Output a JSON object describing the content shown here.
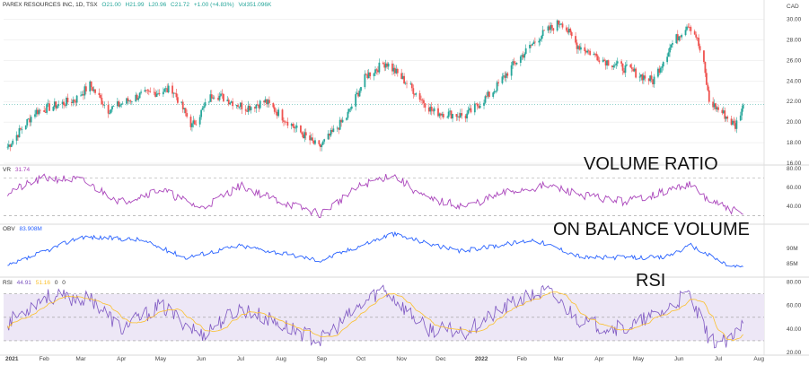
{
  "header": {
    "symbol_line": "PAREX RESOURCES INC, 1D, TSX",
    "open": "O21.00",
    "high": "H21.99",
    "low": "L20.96",
    "close": "C21.72",
    "change": "+1.00 (+4.83%)",
    "volume": "Vol351.096K"
  },
  "currency": "CAD",
  "colors": {
    "up": "#26a69a",
    "down": "#ef5350",
    "vr": "#ab47bc",
    "obv": "#2962ff",
    "rsi": "#7e57c2",
    "rsi_ma": "#fbc02d",
    "rsi_band": "#ede7f6",
    "grid": "#e6e6e6",
    "axis_text": "#444444"
  },
  "annotations": {
    "volume_ratio": "VOLUME RATIO",
    "obv": "ON BALANCE VOLUME",
    "rsi": "RSI"
  },
  "panes": {
    "vr": {
      "name": "VR",
      "value": "31.74"
    },
    "obv": {
      "name": "OBV",
      "value": "83.908M"
    },
    "rsi": {
      "name": "RSI",
      "value": "44.91",
      "ma_value": "51.16",
      "extra1": "0",
      "extra2": "0"
    }
  },
  "chart_data": {
    "type": "candlestick",
    "x_axis_labels": [
      "2021",
      "Feb",
      "Mar",
      "Apr",
      "May",
      "Jun",
      "Jul",
      "Aug",
      "Sep",
      "Oct",
      "Nov",
      "Dec",
      "2022",
      "Feb",
      "Mar",
      "Apr",
      "May",
      "Jun",
      "Jul",
      "Aug"
    ],
    "price_axis": {
      "ticks": [
        "30.00",
        "28.00",
        "26.00",
        "24.00",
        "22.00",
        "20.00",
        "18.00",
        "16.00"
      ],
      "ylim": [
        16,
        31
      ]
    },
    "price_key_points": [
      {
        "date": "2021-01-04",
        "close": 17.6
      },
      {
        "date": "2021-01-25",
        "close": 21.0
      },
      {
        "date": "2021-02-25",
        "close": 22.2
      },
      {
        "date": "2021-03-08",
        "close": 23.6
      },
      {
        "date": "2021-03-22",
        "close": 21.2
      },
      {
        "date": "2021-04-15",
        "close": 22.6
      },
      {
        "date": "2021-05-10",
        "close": 23.2
      },
      {
        "date": "2021-05-25",
        "close": 19.6
      },
      {
        "date": "2021-06-10",
        "close": 22.8
      },
      {
        "date": "2021-07-05",
        "close": 21.4
      },
      {
        "date": "2021-07-20",
        "close": 22.0
      },
      {
        "date": "2021-08-12",
        "close": 19.4
      },
      {
        "date": "2021-08-30",
        "close": 17.5
      },
      {
        "date": "2021-09-20",
        "close": 20.5
      },
      {
        "date": "2021-10-05",
        "close": 24.5
      },
      {
        "date": "2021-10-20",
        "close": 25.8
      },
      {
        "date": "2021-11-05",
        "close": 23.8
      },
      {
        "date": "2021-11-25",
        "close": 21.0
      },
      {
        "date": "2021-12-20",
        "close": 20.6
      },
      {
        "date": "2022-01-10",
        "close": 23.0
      },
      {
        "date": "2022-01-25",
        "close": 25.5
      },
      {
        "date": "2022-02-15",
        "close": 28.4
      },
      {
        "date": "2022-03-03",
        "close": 29.8
      },
      {
        "date": "2022-03-15",
        "close": 27.5
      },
      {
        "date": "2022-04-05",
        "close": 26.0
      },
      {
        "date": "2022-04-25",
        "close": 25.0
      },
      {
        "date": "2022-05-12",
        "close": 24.0
      },
      {
        "date": "2022-05-26",
        "close": 27.5
      },
      {
        "date": "2022-06-08",
        "close": 29.6
      },
      {
        "date": "2022-06-14",
        "close": 28.4
      },
      {
        "date": "2022-06-20",
        "close": 25.5
      },
      {
        "date": "2022-06-24",
        "close": 22.0
      },
      {
        "date": "2022-07-05",
        "close": 20.8
      },
      {
        "date": "2022-07-14",
        "close": 19.6
      },
      {
        "date": "2022-07-20",
        "close": 21.7
      }
    ],
    "vr": {
      "ticks": [
        "80.00",
        "60.00",
        "40.00"
      ],
      "ylim": [
        25,
        82
      ],
      "levels": [
        70,
        30
      ],
      "key_points": [
        {
          "date": "2021-01-04",
          "value": 55
        },
        {
          "date": "2021-02-01",
          "value": 70
        },
        {
          "date": "2021-03-01",
          "value": 68
        },
        {
          "date": "2021-04-01",
          "value": 45
        },
        {
          "date": "2021-05-01",
          "value": 58
        },
        {
          "date": "2021-06-01",
          "value": 38
        },
        {
          "date": "2021-07-01",
          "value": 62
        },
        {
          "date": "2021-08-01",
          "value": 45
        },
        {
          "date": "2021-08-31",
          "value": 32
        },
        {
          "date": "2021-10-01",
          "value": 62
        },
        {
          "date": "2021-10-25",
          "value": 74
        },
        {
          "date": "2021-11-20",
          "value": 48
        },
        {
          "date": "2021-12-20",
          "value": 40
        },
        {
          "date": "2022-01-20",
          "value": 55
        },
        {
          "date": "2022-02-20",
          "value": 62
        },
        {
          "date": "2022-03-20",
          "value": 52
        },
        {
          "date": "2022-04-20",
          "value": 45
        },
        {
          "date": "2022-05-20",
          "value": 55
        },
        {
          "date": "2022-06-08",
          "value": 64
        },
        {
          "date": "2022-06-25",
          "value": 45
        },
        {
          "date": "2022-07-20",
          "value": 31.74
        }
      ]
    },
    "obv": {
      "ticks": [
        "90M",
        "85M"
      ],
      "key_points": [
        {
          "date": "2021-01-04",
          "value": 84
        },
        {
          "date": "2021-03-01",
          "value": 94
        },
        {
          "date": "2021-04-15",
          "value": 93
        },
        {
          "date": "2021-05-20",
          "value": 87
        },
        {
          "date": "2021-07-01",
          "value": 91
        },
        {
          "date": "2021-08-31",
          "value": 86
        },
        {
          "date": "2021-10-25",
          "value": 95
        },
        {
          "date": "2021-12-15",
          "value": 89
        },
        {
          "date": "2022-02-10",
          "value": 93
        },
        {
          "date": "2022-03-20",
          "value": 87
        },
        {
          "date": "2022-05-20",
          "value": 87
        },
        {
          "date": "2022-06-10",
          "value": 91
        },
        {
          "date": "2022-07-10",
          "value": 84
        },
        {
          "date": "2022-07-20",
          "value": 83.9
        }
      ]
    },
    "rsi": {
      "ticks": [
        "80.00",
        "60.00",
        "40.00",
        "20.00"
      ],
      "ylim": [
        20,
        82
      ],
      "levels": [
        70,
        50,
        30
      ],
      "key_points": [
        {
          "date": "2021-01-04",
          "value": 45
        },
        {
          "date": "2021-02-01",
          "value": 68
        },
        {
          "date": "2021-03-10",
          "value": 65
        },
        {
          "date": "2021-04-01",
          "value": 40
        },
        {
          "date": "2021-05-01",
          "value": 60
        },
        {
          "date": "2021-06-01",
          "value": 35
        },
        {
          "date": "2021-07-01",
          "value": 58
        },
        {
          "date": "2021-08-31",
          "value": 30
        },
        {
          "date": "2021-10-01",
          "value": 60
        },
        {
          "date": "2021-10-18",
          "value": 75
        },
        {
          "date": "2021-11-20",
          "value": 40
        },
        {
          "date": "2021-12-20",
          "value": 38
        },
        {
          "date": "2022-01-25",
          "value": 62
        },
        {
          "date": "2022-02-20",
          "value": 73
        },
        {
          "date": "2022-03-20",
          "value": 45
        },
        {
          "date": "2022-04-20",
          "value": 40
        },
        {
          "date": "2022-05-20",
          "value": 55
        },
        {
          "date": "2022-06-08",
          "value": 70
        },
        {
          "date": "2022-06-25",
          "value": 30
        },
        {
          "date": "2022-07-10",
          "value": 28
        },
        {
          "date": "2022-07-20",
          "value": 44.91
        }
      ]
    }
  }
}
